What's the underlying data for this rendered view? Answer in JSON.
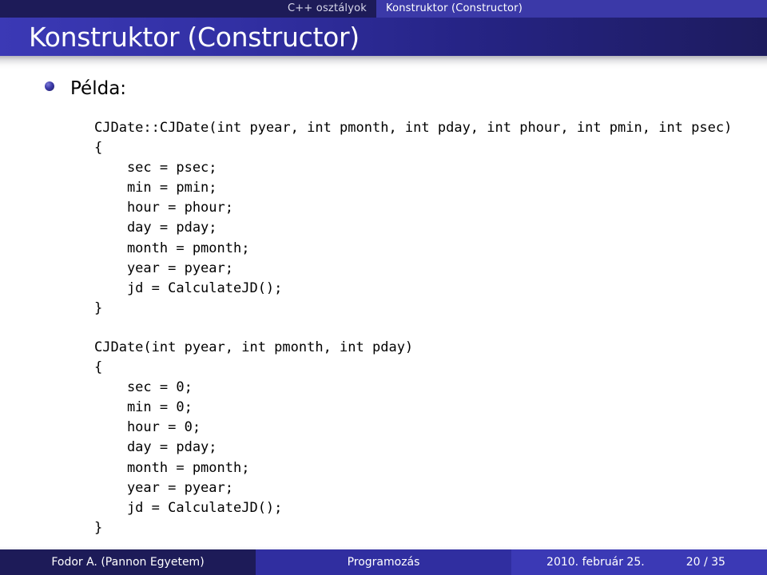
{
  "navbar": {
    "section": "C++ osztályok",
    "subsection": "Konstruktor (Constructor)"
  },
  "title": "Konstruktor (Constructor)",
  "body": {
    "bullet_label": "Példa:",
    "bullet_icon": "bullet-sphere-icon",
    "code_block_1": [
      "CJDate::CJDate(int pyear, int pmonth, int pday, int phour, int pmin, int psec)",
      "{",
      "    sec = psec;",
      "    min = pmin;",
      "    hour = phour;",
      "    day = pday;",
      "    month = pmonth;",
      "    year = pyear;",
      "    jd = CalculateJD();",
      "}"
    ],
    "code_block_2": [
      "CJDate(int pyear, int pmonth, int pday)",
      "{",
      "    sec = 0;",
      "    min = 0;",
      "    hour = 0;",
      "    day = pday;",
      "    month = pmonth;",
      "    year = pyear;",
      "    jd = CalculateJD();",
      "}"
    ]
  },
  "footer": {
    "author": "Fodor A.  (Pannon Egyetem)",
    "presentation_title": "Programozás",
    "date": "2010. február 25.",
    "page": "20 / 35"
  },
  "colors": {
    "nav_dark": "#1d1b58",
    "nav_light": "#3b39a8",
    "title_gradient_start": "#3b39b5",
    "title_gradient_end": "#1d1b5e",
    "background": "#ffffff",
    "text": "#000000"
  }
}
